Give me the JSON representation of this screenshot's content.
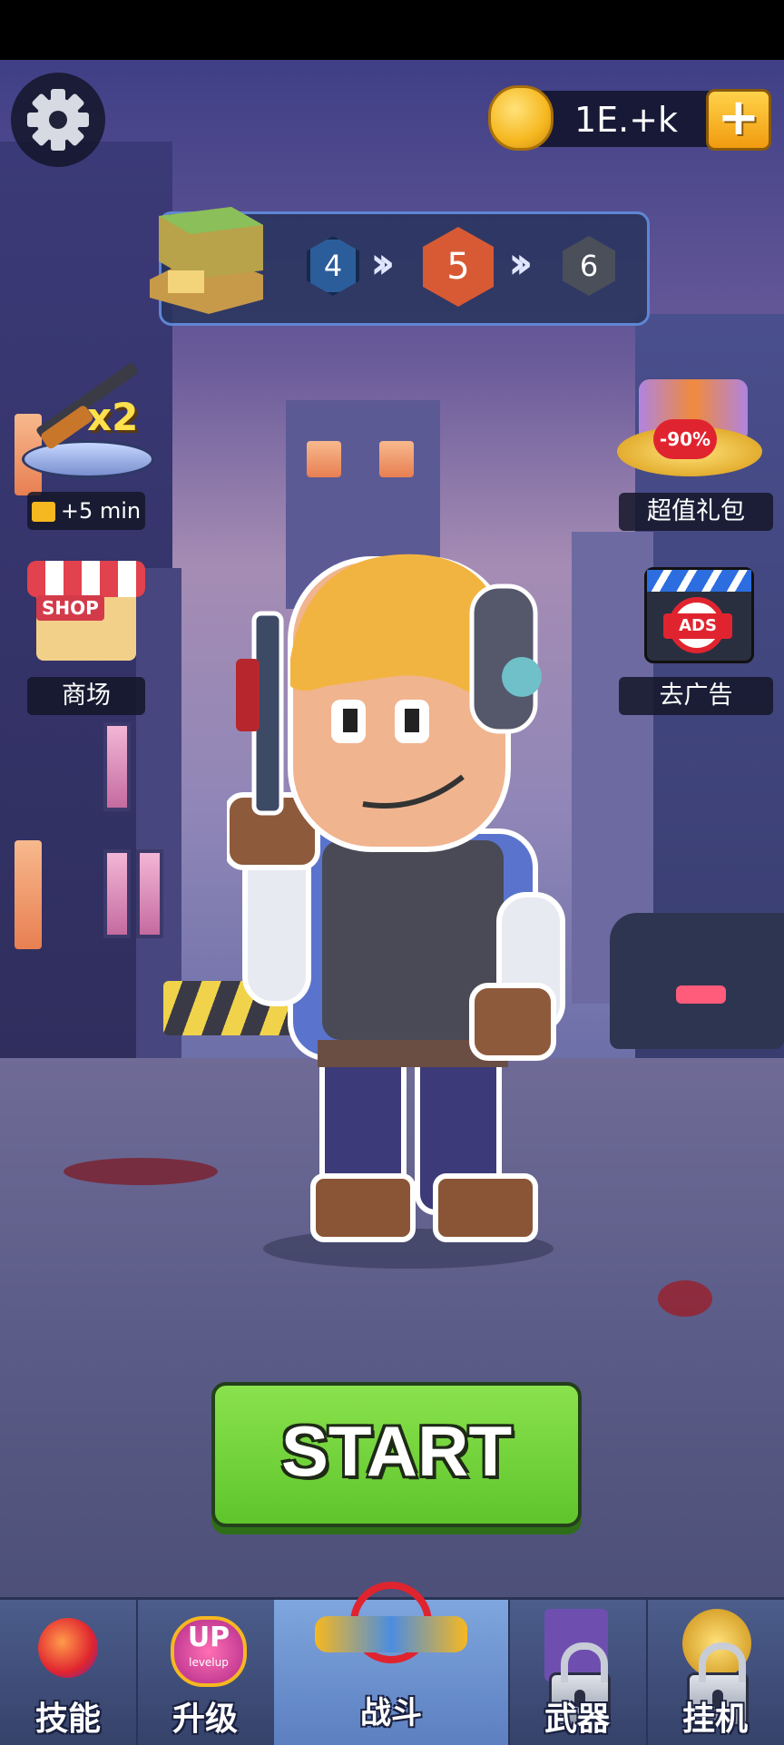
{
  "status_bar": {},
  "top": {
    "coins": "1E.+k",
    "add_symbol": "+"
  },
  "stage_progress": {
    "prev": "4",
    "current": "5",
    "next": "6"
  },
  "left_panel": {
    "weapon_boost": {
      "multiplier": "x2",
      "ad_label": "+5 min"
    },
    "shop": {
      "sign": "SHOP",
      "label": "商场"
    }
  },
  "right_panel": {
    "gift_pack": {
      "badge": "-90%",
      "label": "超值礼包"
    },
    "remove_ads": {
      "icon_text": "ADS",
      "label": "去广告"
    }
  },
  "start_button": {
    "label": "START"
  },
  "bottom_nav": [
    {
      "label": "技能",
      "locked": false,
      "active": false
    },
    {
      "label": "升级",
      "locked": false,
      "active": false,
      "badge_top": "UP",
      "badge_bottom": "levelup"
    },
    {
      "label": "战斗",
      "locked": false,
      "active": true
    },
    {
      "label": "武器",
      "locked": true,
      "active": false
    },
    {
      "label": "挂机",
      "locked": true,
      "active": false
    }
  ],
  "colors": {
    "start_green": "#6fd63a",
    "current_stage": "#d75a35",
    "prev_stage": "#2b5d9a",
    "next_stage": "#4a4f5a",
    "coin_gold": "#f6b820"
  }
}
